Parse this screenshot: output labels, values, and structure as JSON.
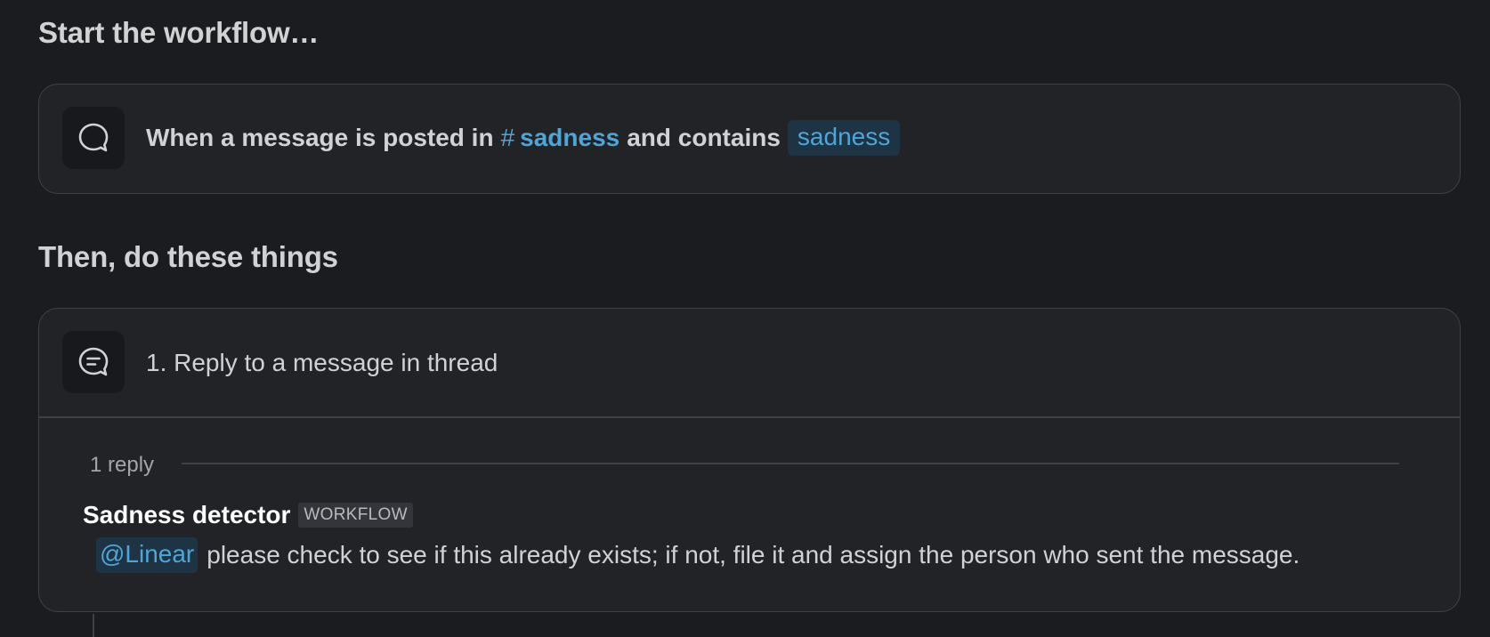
{
  "headings": {
    "start": "Start the workflow…",
    "then": "Then, do these things"
  },
  "trigger": {
    "icon": "message-bubble-icon",
    "prefix": "When a message is posted in",
    "channel_hash": "#",
    "channel_name": "sadness",
    "middle": "and contains",
    "keyword": "sadness"
  },
  "step": {
    "icon": "reply-thread-icon",
    "title": "1. Reply to a message in thread",
    "reply_count": "1 reply",
    "sender": "Sadness detector",
    "badge": "WORKFLOW",
    "mention": "@Linear",
    "message": "please check to see if this already exists; if not, file it and assign the person who sent the message."
  },
  "colors": {
    "background": "#1b1c20",
    "card": "#222327",
    "link": "#4ea6d8",
    "chip": "#1e3445"
  }
}
